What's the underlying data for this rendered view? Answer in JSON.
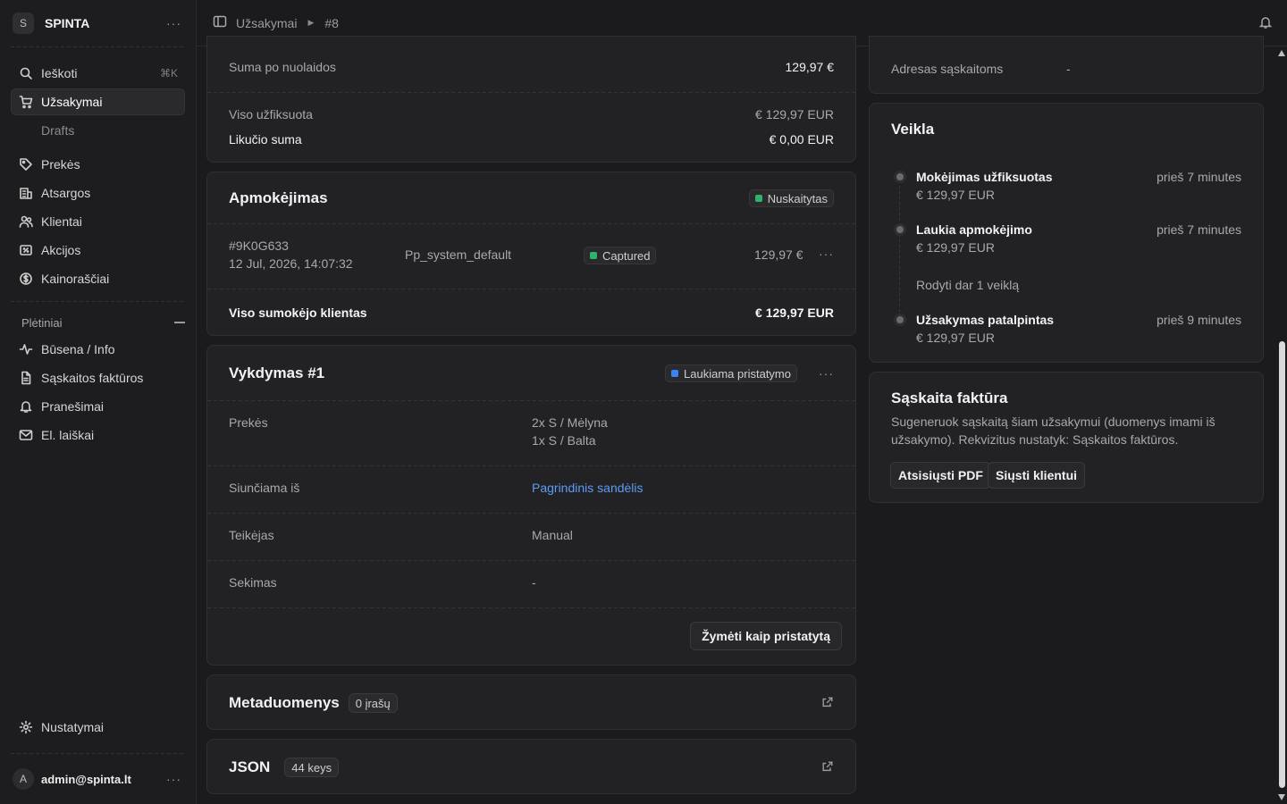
{
  "sidebar": {
    "store_initial": "S",
    "store_name": "SPINTA",
    "search_label": "Ieškoti",
    "search_shortcut": "⌘K",
    "nav": [
      {
        "label": "Užsakymai",
        "icon": "shopping-cart-icon",
        "active": true
      },
      {
        "label": "Drafts"
      },
      {
        "label": "Prekės",
        "icon": "tag-icon"
      },
      {
        "label": "Atsargos",
        "icon": "building-icon"
      },
      {
        "label": "Klientai",
        "icon": "users-icon"
      },
      {
        "label": "Akcijos",
        "icon": "receipt-percent-icon"
      },
      {
        "label": "Kainoraščiai",
        "icon": "currency-dollar-icon"
      }
    ],
    "extensions_title": "Plėtiniai",
    "extensions": [
      {
        "label": "Būsena / Info",
        "icon": "activity-icon"
      },
      {
        "label": "Sąskaitos faktūros",
        "icon": "document-icon"
      },
      {
        "label": "Pranešimai",
        "icon": "bell-icon"
      },
      {
        "label": "El. laiškai",
        "icon": "envelope-icon"
      }
    ],
    "settings_label": "Nustatymai",
    "user_initial": "A",
    "user_email": "admin@spinta.lt"
  },
  "topbar": {
    "breadcrumb_root": "Užsakymai",
    "breadcrumb_current": "#8"
  },
  "summary": {
    "discount_label": "Suma po nuolaidos",
    "discount_value": "129,97 €",
    "captured_label": "Viso užfiksuota",
    "captured_value": "€ 129,97 EUR",
    "balance_label": "Likučio suma",
    "balance_value": "€ 0,00 EUR"
  },
  "payment": {
    "title": "Apmokėjimas",
    "status": "Nuskaitytas",
    "status_color": "#2fb36b",
    "id": "#9K0G633",
    "date": "12 Jul, 2026, 14:07:32",
    "provider": "Pp_system_default",
    "capture_status": "Captured",
    "amount": "129,97 €",
    "total_label": "Viso sumokėjo klientas",
    "total_value": "€ 129,97 EUR"
  },
  "fulfillment": {
    "title": "Vykdymas #1",
    "status": "Laukiama pristatymo",
    "status_color": "#3b82f6",
    "items_label": "Prekės",
    "items": [
      "2x S / Mėlyna",
      "1x S / Balta"
    ],
    "ship_from_label": "Siunčiama iš",
    "ship_from_value": "Pagrindinis sandėlis",
    "provider_label": "Teikėjas",
    "provider_value": "Manual",
    "tracking_label": "Sekimas",
    "tracking_value": "-",
    "mark_delivered": "Žymėti kaip pristatytą"
  },
  "metadata": {
    "title": "Metaduomenys",
    "count": "0 įrašų"
  },
  "json": {
    "title": "JSON",
    "count": "44 keys"
  },
  "address": {
    "billing_label": "Adresas sąskaitoms",
    "billing_value": "-"
  },
  "activity": {
    "title": "Veikla",
    "events": [
      {
        "title": "Mokėjimas užfiksuotas",
        "amount": "€ 129,97 EUR",
        "time": "prieš 7 minutes"
      },
      {
        "title": "Laukia apmokėjimo",
        "amount": "€ 129,97 EUR",
        "time": "prieš 7 minutes"
      },
      {
        "title": "Užsakymas patalpintas",
        "amount": "€ 129,97 EUR",
        "time": "prieš 9 minutes"
      }
    ],
    "show_more": "Rodyti dar 1 veiklą"
  },
  "invoice": {
    "title": "Sąskaita faktūra",
    "description": "Sugeneruok sąskaitą šiam užsakymui (duomenys imami iš užsakymo). Rekvizitus nustatyk: Sąskaitos faktūros.",
    "download_label": "Atsisiųsti PDF",
    "send_label": "Siųsti klientui"
  }
}
